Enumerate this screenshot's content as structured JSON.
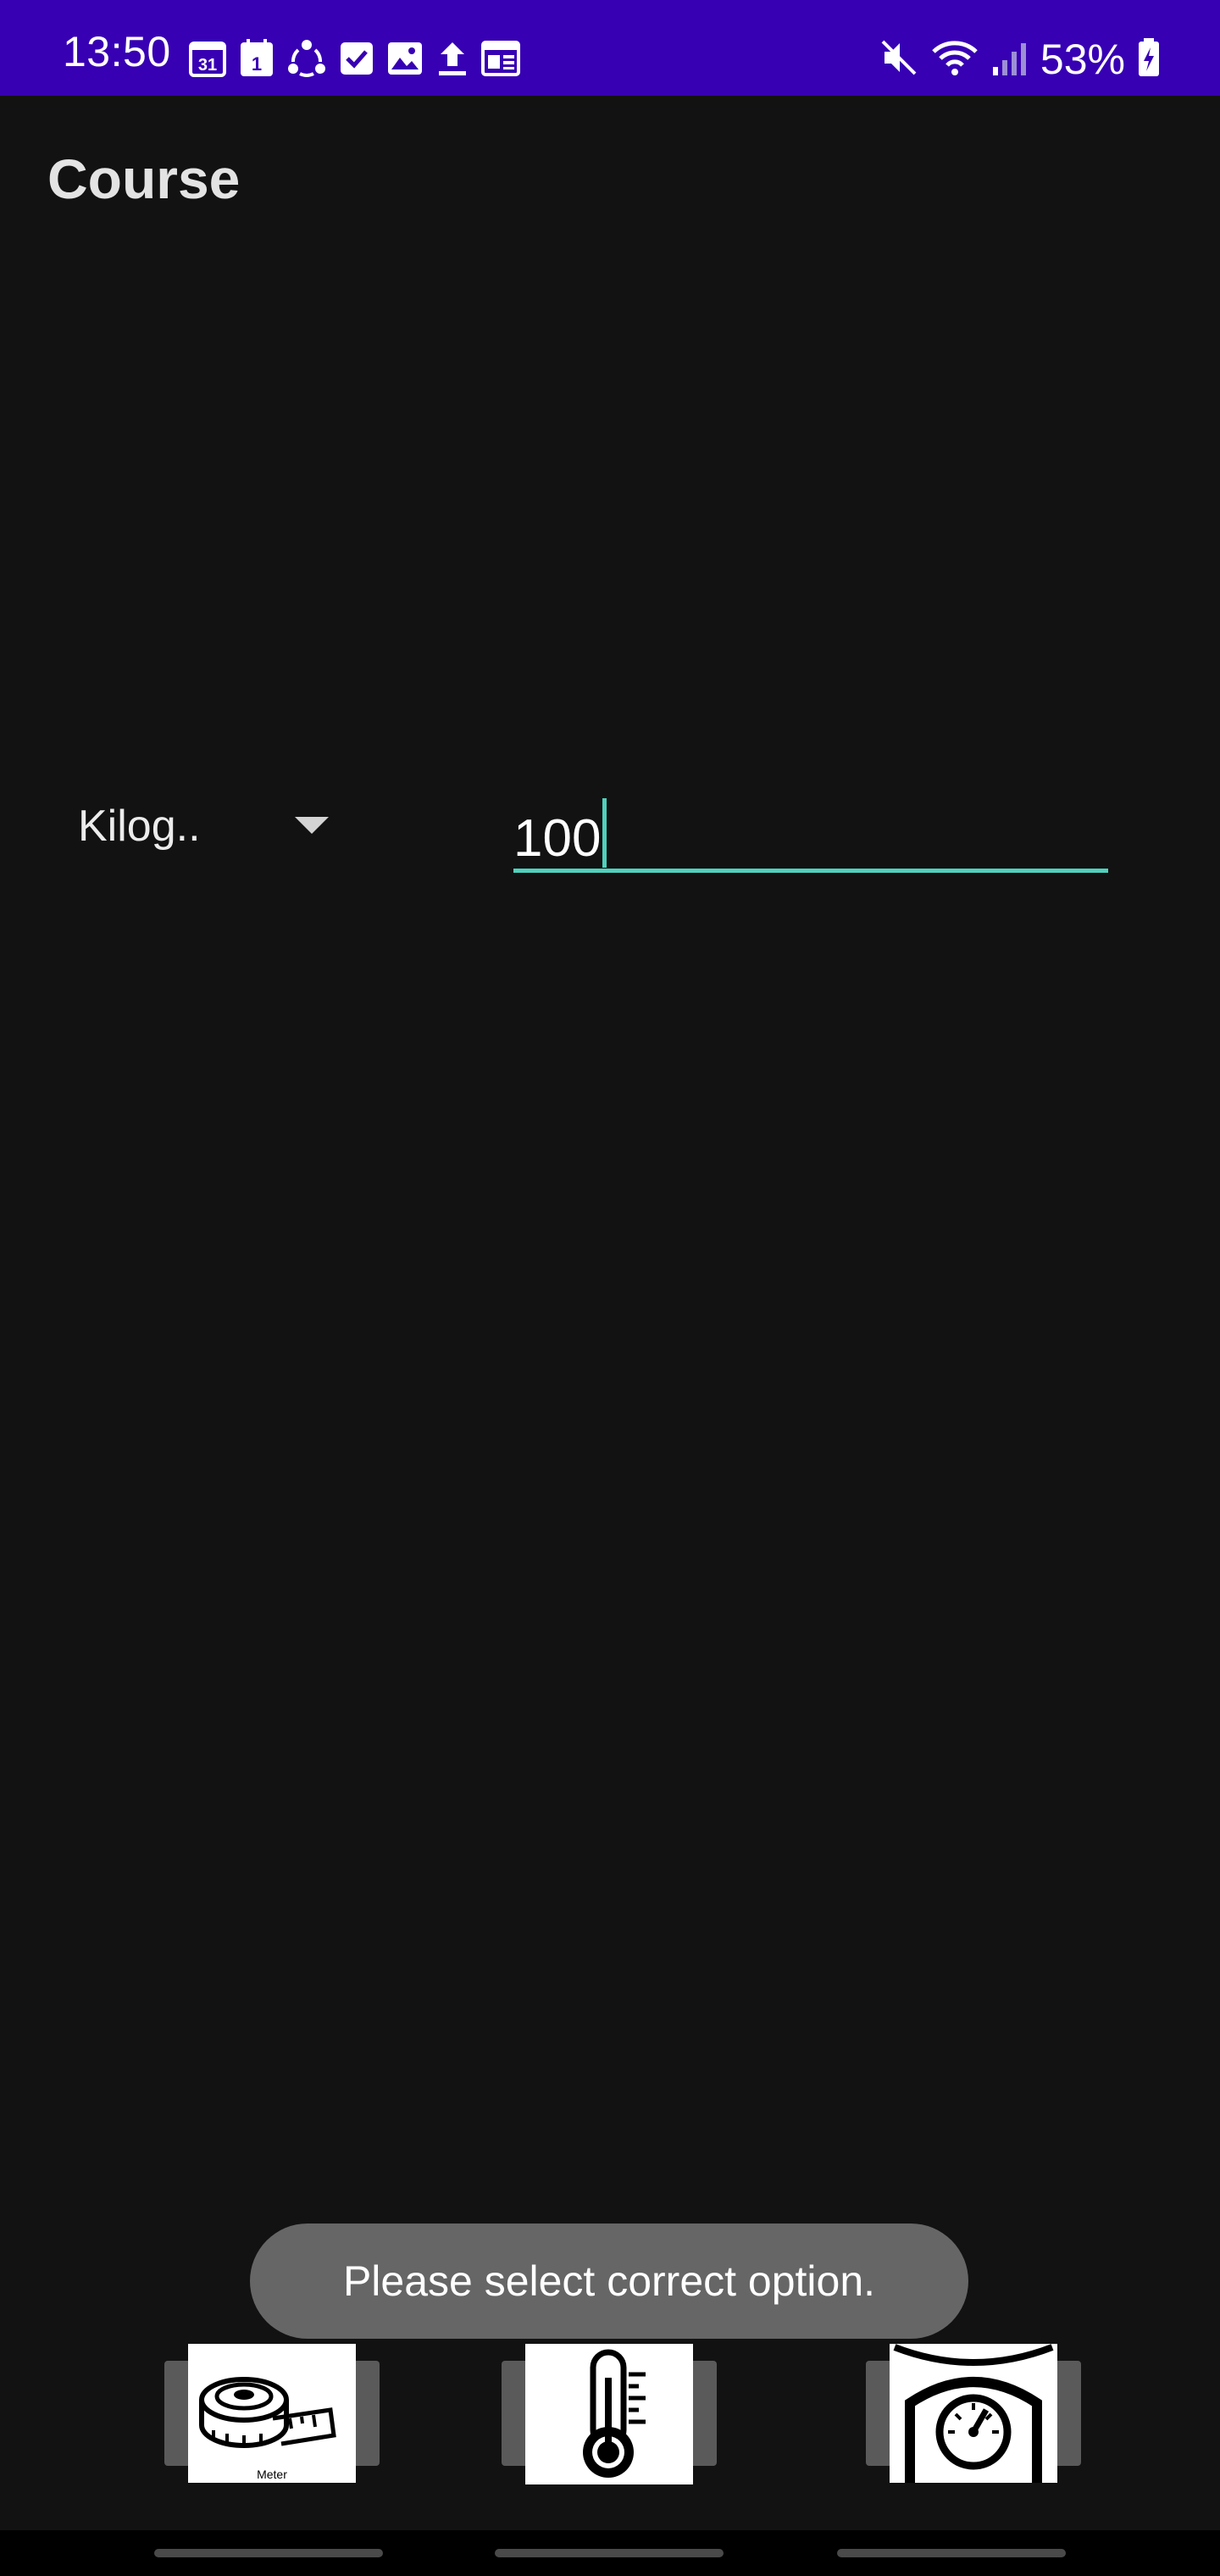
{
  "status_bar": {
    "time": "13:50",
    "calendar_day": "31",
    "notification_day": "1",
    "battery": "53%",
    "icons_left": [
      "calendar-icon",
      "calendar-day-icon",
      "sync-icon",
      "tasks-icon",
      "gallery-icon",
      "upload-icon",
      "news-icon"
    ],
    "icons_right": [
      "mute-icon",
      "wifi-icon",
      "signal-icon",
      "battery-icon"
    ]
  },
  "app_bar": {
    "title": "Course"
  },
  "converter": {
    "unit_selected": "Kilog..",
    "amount_value": "100"
  },
  "toast": {
    "message": "Please select correct option."
  },
  "bottom_buttons": [
    {
      "icon": "tape-measure-icon",
      "caption": "Meter"
    },
    {
      "icon": "thermometer-icon"
    },
    {
      "icon": "kitchen-scale-icon"
    }
  ],
  "colors": {
    "status_bar": "#3700b3",
    "background": "#121212",
    "accent": "#4fd1bd",
    "toast": "#666666"
  }
}
